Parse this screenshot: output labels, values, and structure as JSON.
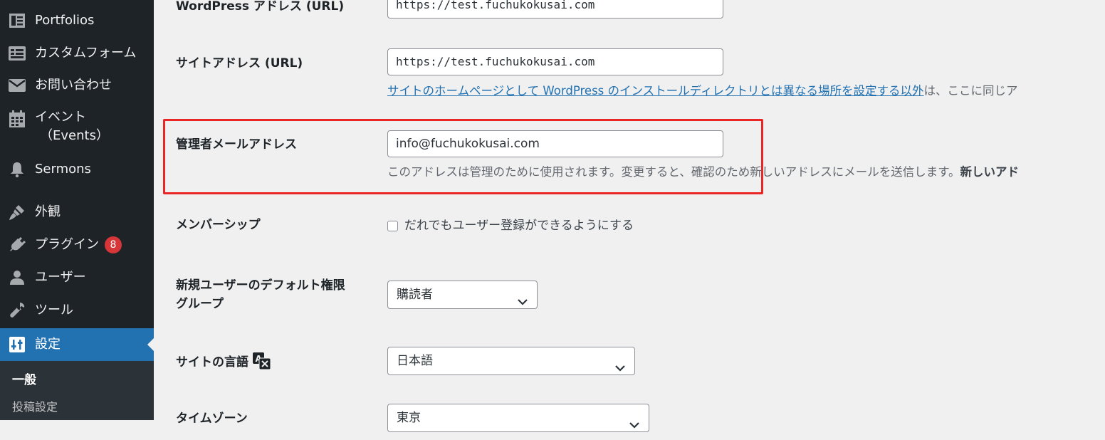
{
  "sidebar": {
    "items": [
      {
        "label": "Portfolios",
        "icon": "portfolio-icon"
      },
      {
        "label": "カスタムフォーム",
        "icon": "form-icon"
      },
      {
        "label": "お問い合わせ",
        "icon": "mail-icon"
      },
      {
        "label": "イベント",
        "label2": "（Events）",
        "icon": "calendar-icon"
      },
      {
        "label": "Sermons",
        "icon": "bell-icon"
      },
      {
        "label": "外観",
        "icon": "brush-icon"
      },
      {
        "label": "プラグイン",
        "badge": "8",
        "icon": "plugin-icon"
      },
      {
        "label": "ユーザー",
        "icon": "user-icon"
      },
      {
        "label": "ツール",
        "icon": "wrench-icon"
      },
      {
        "label": "設定",
        "icon": "settings-icon",
        "active": true
      }
    ],
    "submenu": [
      "一般",
      "投稿設定"
    ]
  },
  "form": {
    "wp_address_label": "WordPress アドレス (URL)",
    "wp_address_value": "https://test.fuchukokusai.com",
    "site_address_label": "サイトアドレス (URL)",
    "site_address_value": "https://test.fuchukokusai.com",
    "site_address_desc_link": "サイトのホームページとして WordPress のインストールディレクトリとは異なる場所を設定する以外",
    "site_address_desc_rest": "は、ここに同じア",
    "admin_email_label": "管理者メールアドレス",
    "admin_email_value": "info@fuchukokusai.com",
    "admin_email_desc": "このアドレスは管理のために使用されます。変更すると、確認のため新しいアドレスにメールを送信します。",
    "admin_email_desc_bold": "新しいアド",
    "membership_label": "メンバーシップ",
    "membership_checkbox_label": "だれでもユーザー登録ができるようにする",
    "default_role_label_line1": "新規ユーザーのデフォルト権限",
    "default_role_label_line2": "グループ",
    "default_role_value": "購読者",
    "site_language_label": "サイトの言語",
    "site_language_value": "日本語",
    "timezone_label": "タイムゾーン",
    "timezone_value": "東京"
  },
  "colors": {
    "sidebar_bg": "#1d2327",
    "active_bg": "#2271b1",
    "badge": "#d63638",
    "highlight_border": "#ea2525",
    "link": "#2271b1"
  }
}
